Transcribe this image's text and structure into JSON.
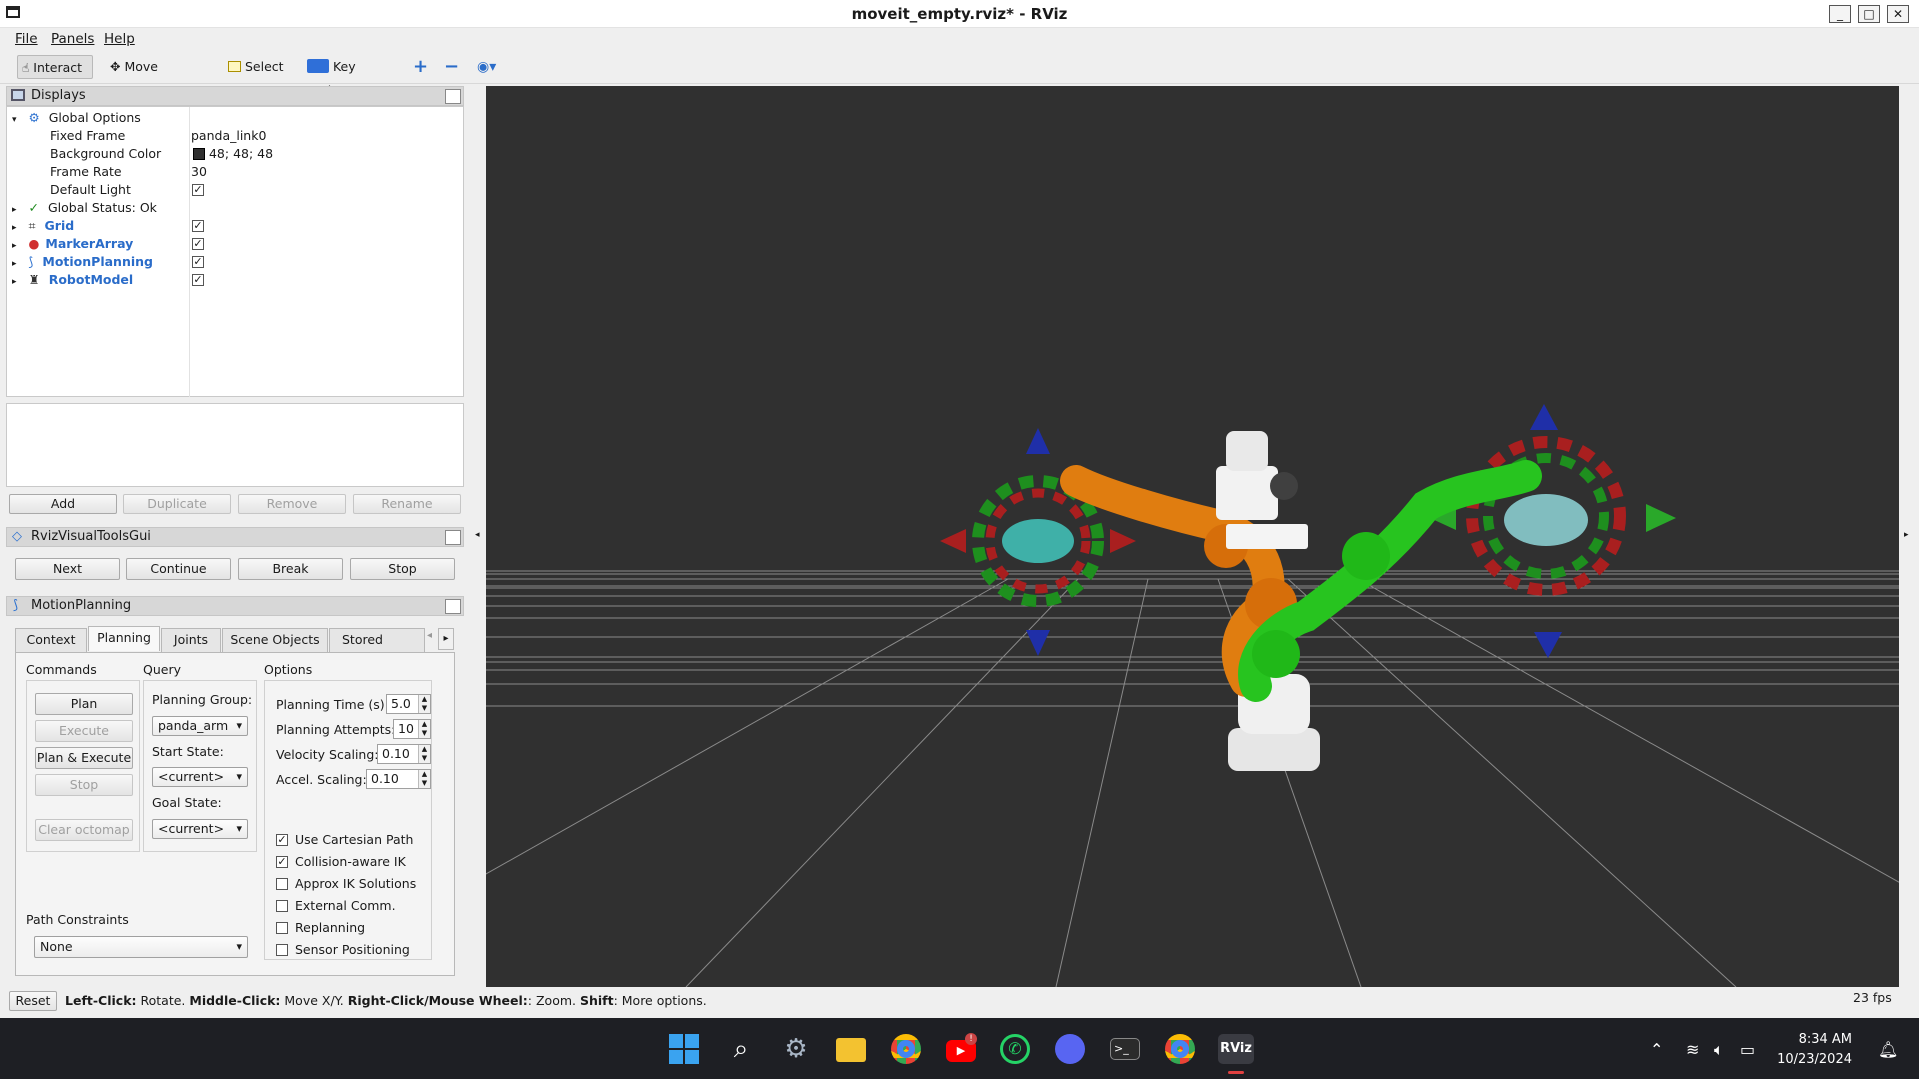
{
  "window": {
    "title": "moveit_empty.rviz* - RViz",
    "controls": [
      "_",
      "□",
      "✕"
    ]
  },
  "menubar": [
    {
      "label": "File"
    },
    {
      "label": "Panels"
    },
    {
      "label": "Help"
    }
  ],
  "toolbar": {
    "interact": "Interact",
    "move_camera": "Move Camera",
    "select": "Select",
    "key_tool": "Key Tool"
  },
  "displays": {
    "title": "Displays",
    "global_options": "Global Options",
    "props": [
      {
        "name": "Fixed Frame",
        "value": "panda_link0"
      },
      {
        "name": "Background Color",
        "value": "48; 48; 48"
      },
      {
        "name": "Frame Rate",
        "value": "30"
      },
      {
        "name": "Default Light",
        "value": "✓"
      }
    ],
    "global_status": "Global Status: Ok",
    "items": [
      {
        "label": "Grid",
        "checked": "✓"
      },
      {
        "label": "MarkerArray",
        "checked": "✓"
      },
      {
        "label": "MotionPlanning",
        "checked": "✓"
      },
      {
        "label": "RobotModel",
        "checked": "✓"
      }
    ],
    "buttons": {
      "add": "Add",
      "duplicate": "Duplicate",
      "remove": "Remove",
      "rename": "Rename"
    }
  },
  "visual_tools": {
    "title": "RvizVisualToolsGui",
    "buttons": {
      "next": "Next",
      "continue": "Continue",
      "break": "Break",
      "stop": "Stop"
    }
  },
  "motion_planning": {
    "title": "MotionPlanning",
    "tabs": [
      "Context",
      "Planning",
      "Joints",
      "Scene Objects",
      "Stored Scenes"
    ],
    "commands": {
      "header": "Commands",
      "plan": "Plan",
      "execute": "Execute",
      "plan_execute": "Plan & Execute",
      "stop": "Stop",
      "clear_octomap": "Clear octomap"
    },
    "query": {
      "header": "Query",
      "planning_group_label": "Planning Group:",
      "planning_group": "panda_arm",
      "start_state_label": "Start State:",
      "start_state": "<current>",
      "goal_state_label": "Goal State:",
      "goal_state": "<current>"
    },
    "options": {
      "header": "Options",
      "planning_time_label": "Planning Time (s):",
      "planning_time": "5.0",
      "planning_attempts_label": "Planning Attempts:",
      "planning_attempts": "10",
      "velocity_scaling_label": "Velocity Scaling:",
      "velocity_scaling": "0.10",
      "accel_scaling_label": "Accel. Scaling:",
      "accel_scaling": "0.10",
      "checkboxes": [
        {
          "label": "Use Cartesian Path",
          "checked": "✓"
        },
        {
          "label": "Collision-aware IK",
          "checked": "✓"
        },
        {
          "label": "Approx IK Solutions",
          "checked": ""
        },
        {
          "label": "External Comm.",
          "checked": ""
        },
        {
          "label": "Replanning",
          "checked": ""
        },
        {
          "label": "Sensor Positioning",
          "checked": ""
        }
      ]
    },
    "path_constraints_label": "Path Constraints",
    "path_constraints": "None"
  },
  "statusbar": {
    "reset": "Reset",
    "help": {
      "b1": "Left-Click:",
      "t1": " Rotate. ",
      "b2": "Middle-Click:",
      "t2": " Move X/Y. ",
      "b3": "Right-Click/Mouse Wheel:",
      "t3": ": Zoom. ",
      "b4": "Shift",
      "t4": ": More options."
    },
    "fps": "23 fps"
  },
  "taskbar": {
    "clock_time": "8:34 AM",
    "clock_date": "10/23/2024",
    "rviz_label": "RViz",
    "badge": "!"
  }
}
